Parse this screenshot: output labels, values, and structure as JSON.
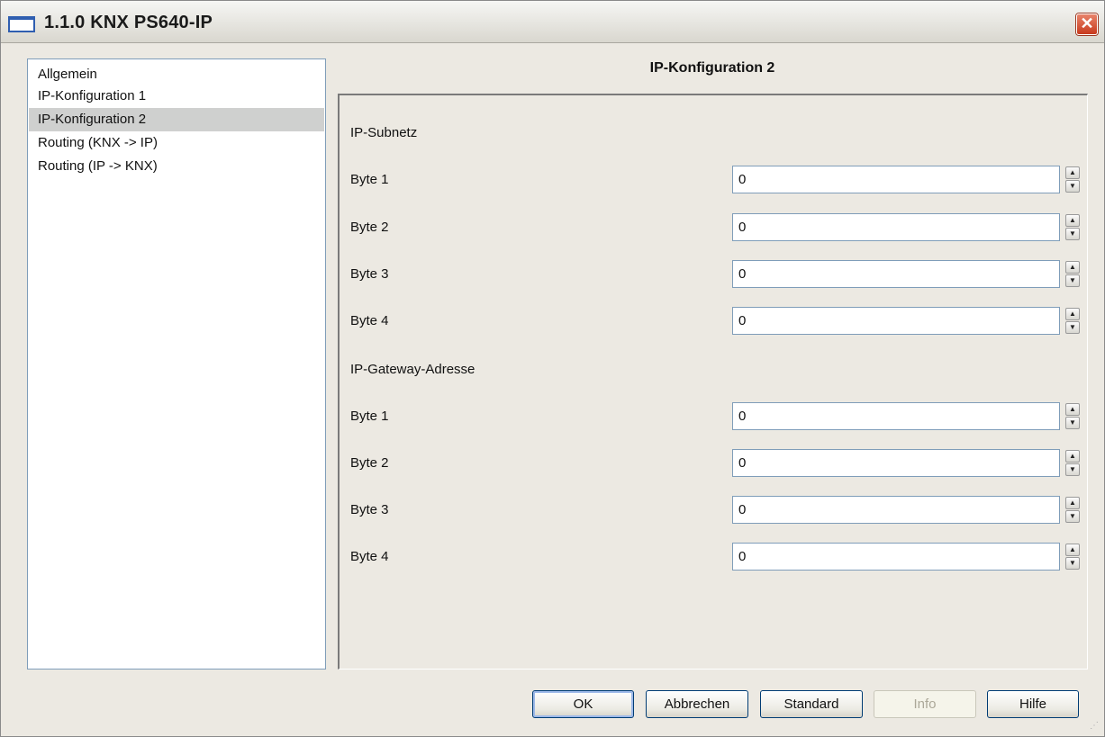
{
  "window": {
    "title": "1.1.0 KNX PS640-IP",
    "close_label": "✕"
  },
  "nav": {
    "items": [
      {
        "label": "Allgemein",
        "selected": false
      },
      {
        "label": "IP-Konfiguration 1",
        "selected": false
      },
      {
        "label": "IP-Konfiguration 2",
        "selected": true
      },
      {
        "label": "Routing (KNX -> IP)",
        "selected": false
      },
      {
        "label": "Routing (IP -> KNX)",
        "selected": false
      }
    ]
  },
  "panel": {
    "title": "IP-Konfiguration 2",
    "subnet": {
      "heading": "IP-Subnetz",
      "rows": [
        {
          "label": "Byte 1",
          "value": "0"
        },
        {
          "label": "Byte 2",
          "value": "0"
        },
        {
          "label": "Byte 3",
          "value": "0"
        },
        {
          "label": "Byte 4",
          "value": "0"
        }
      ]
    },
    "gateway": {
      "heading": "IP-Gateway-Adresse",
      "rows": [
        {
          "label": "Byte 1",
          "value": "0"
        },
        {
          "label": "Byte 2",
          "value": "0"
        },
        {
          "label": "Byte 3",
          "value": "0"
        },
        {
          "label": "Byte 4",
          "value": "0"
        }
      ]
    }
  },
  "buttons": {
    "ok": "OK",
    "cancel": "Abbrechen",
    "standard": "Standard",
    "info": "Info",
    "help": "Hilfe"
  },
  "icons": {
    "spin_up": "▲",
    "spin_down": "▼",
    "resize_grip": "⋰"
  }
}
